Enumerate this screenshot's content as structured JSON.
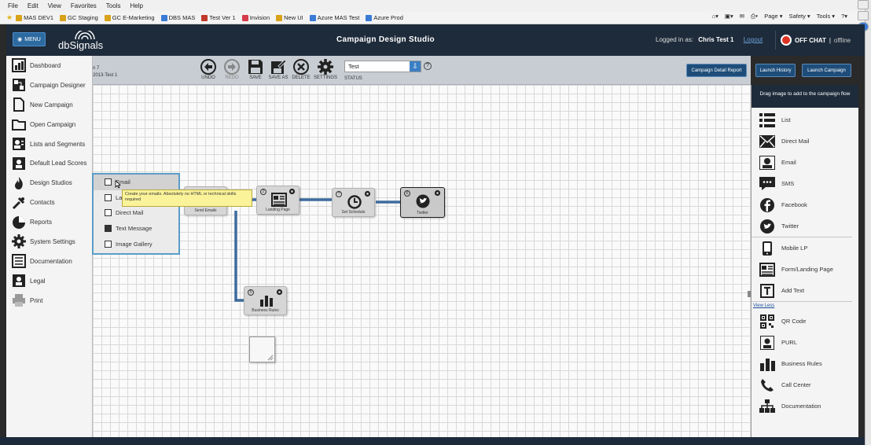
{
  "browser": {
    "menu": [
      "File",
      "Edit",
      "View",
      "Favorites",
      "Tools",
      "Help"
    ],
    "favorites": [
      {
        "label": "MAS DEV1",
        "color": "#d8a31a"
      },
      {
        "label": "GC Staging",
        "color": "#d8a31a"
      },
      {
        "label": "GC E-Marketing",
        "color": "#d8a31a"
      },
      {
        "label": "DBS MAS",
        "color": "#3a7bd5"
      },
      {
        "label": "Test Ver 1",
        "color": "#c0392b"
      },
      {
        "label": "Invision",
        "color": "#d63b4c"
      },
      {
        "label": "New UI",
        "color": "#d8a31a"
      },
      {
        "label": "Azure MAS Test",
        "color": "#3a7bd5"
      },
      {
        "label": "Azure Prod",
        "color": "#3a7bd5"
      }
    ],
    "right_tools": [
      "Page ▾",
      "Safety ▾",
      "Tools ▾"
    ]
  },
  "header": {
    "menu_label": "MENU",
    "logo_text": "dbSignals",
    "title": "Campaign Design Studio",
    "logged_in_label": "Logged in as:",
    "user": "Chris Test 1",
    "logout": "Logout",
    "chat_label": "OFF CHAT",
    "chat_status": "offline"
  },
  "left_menu": [
    {
      "label": "Dashboard",
      "icon": "dashboard-icon"
    },
    {
      "label": "Campaign Designer",
      "icon": "campaign-designer-icon"
    },
    {
      "label": "New Campaign",
      "icon": "new-campaign-icon"
    },
    {
      "label": "Open Campaign",
      "icon": "folder-icon"
    },
    {
      "label": "Lists and Segments",
      "icon": "lists-icon"
    },
    {
      "label": "Default Lead Scores",
      "icon": "lead-scores-icon"
    },
    {
      "label": "Design Studios",
      "icon": "flame-icon"
    },
    {
      "label": "Contacts",
      "icon": "contacts-icon"
    },
    {
      "label": "Reports",
      "icon": "pie-chart-icon"
    },
    {
      "label": "System Settings",
      "icon": "gear-icon"
    },
    {
      "label": "Documentation",
      "icon": "documentation-icon"
    },
    {
      "label": "Legal",
      "icon": "legal-icon"
    },
    {
      "label": "Print",
      "icon": "print-icon"
    }
  ],
  "toolbar": {
    "breadcrumb_line1": "n 7",
    "breadcrumb_line2": "2013-Test 1",
    "undo": "UNDO",
    "redo": "REDO",
    "save": "SAVE",
    "save_as": "SAVE AS",
    "delete": "DELETE",
    "settings": "SETTINGS",
    "status_value": "Test",
    "status_label": "STATUS",
    "status_help": "?",
    "campaign_detail_report": "Campaign Detail Report",
    "launch_history": "Launch History",
    "launch_campaign": "Launch Campaign"
  },
  "canvas": {
    "nodes": [
      {
        "label": "Send Emails",
        "num": "1"
      },
      {
        "label": "Landing Page",
        "num": "2"
      },
      {
        "label": "Set Schedule",
        "num": "?"
      },
      {
        "label": "Twitter",
        "num": "6"
      },
      {
        "label": "Business Rules",
        "num": "5"
      }
    ],
    "popup": [
      {
        "label": "Email"
      },
      {
        "label": "La"
      },
      {
        "label": "Direct Mail"
      },
      {
        "label": "Text Message"
      },
      {
        "label": "Image Gallery"
      }
    ],
    "tooltip": "Create your emails. Absolutely no HTML or technical skills required"
  },
  "right_panel": {
    "header": "Drag image to add to the campaign flow",
    "group1": [
      {
        "label": "List",
        "icon": "list-icon"
      },
      {
        "label": "Direct Mail",
        "icon": "envelope-icon"
      },
      {
        "label": "Email",
        "icon": "email-icon"
      },
      {
        "label": "SMS",
        "icon": "sms-icon"
      },
      {
        "label": "Facebook",
        "icon": "facebook-icon"
      },
      {
        "label": "Twitter",
        "icon": "twitter-icon"
      }
    ],
    "group2": [
      {
        "label": "Mobile LP",
        "icon": "mobile-icon"
      },
      {
        "label": "Form/Landing Page",
        "icon": "form-icon"
      },
      {
        "label": "Add Text",
        "icon": "text-icon"
      }
    ],
    "view_less": "View Less",
    "group3": [
      {
        "label": "QR Code",
        "icon": "qr-code-icon"
      },
      {
        "label": "PURL",
        "icon": "purl-icon"
      },
      {
        "label": "Business Rules",
        "icon": "bar-chart-icon"
      },
      {
        "label": "Call Center",
        "icon": "phone-icon"
      },
      {
        "label": "Documentation",
        "icon": "org-chart-icon"
      }
    ]
  },
  "colors": {
    "header_bg": "#1e2b3a",
    "accent_blue": "#3b7fc4",
    "connector": "#3d6b9c",
    "popup_border": "#5a9dc7",
    "tooltip_bg": "#fbf39a"
  }
}
